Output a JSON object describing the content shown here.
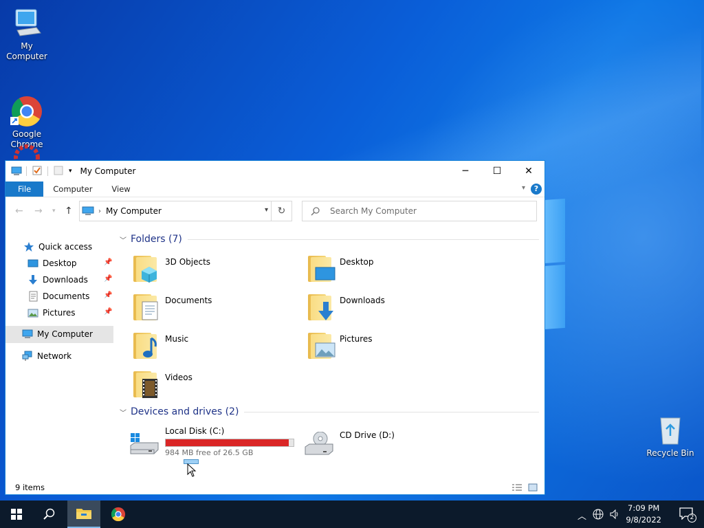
{
  "desktop": {
    "icons": [
      {
        "label": "My Computer"
      },
      {
        "label": "Google\nChrome"
      },
      {
        "label": "Recycle Bin"
      }
    ]
  },
  "window": {
    "title": "My Computer",
    "ribbon_tabs": [
      "File",
      "Computer",
      "View"
    ],
    "address": {
      "crumb": "My Computer"
    },
    "search": {
      "placeholder": "Search My Computer"
    },
    "controls": {
      "minimize": "─",
      "maximize": "☐",
      "close": "✕"
    },
    "nav": {
      "quick_access": "Quick access",
      "items": [
        "Desktop",
        "Downloads",
        "Documents",
        "Pictures"
      ],
      "my_computer": "My Computer",
      "network": "Network"
    },
    "folders_header": "Folders (7)",
    "folders": [
      "3D Objects",
      "Desktop",
      "Documents",
      "Downloads",
      "Music",
      "Pictures",
      "Videos"
    ],
    "devices_header": "Devices and drives (2)",
    "drives": [
      {
        "name": "Local Disk (C:)",
        "free": "984 MB free of 26.5 GB",
        "used_fraction": 0.964
      },
      {
        "name": "CD Drive (D:)"
      }
    ],
    "status": "9 items"
  },
  "taskbar": {
    "time": "7:09 PM",
    "date": "9/8/2022",
    "notification_count": "2"
  },
  "colors": {
    "accent": "#1979ca",
    "drive_bar": "#da2626",
    "section_header": "#1e3287"
  }
}
